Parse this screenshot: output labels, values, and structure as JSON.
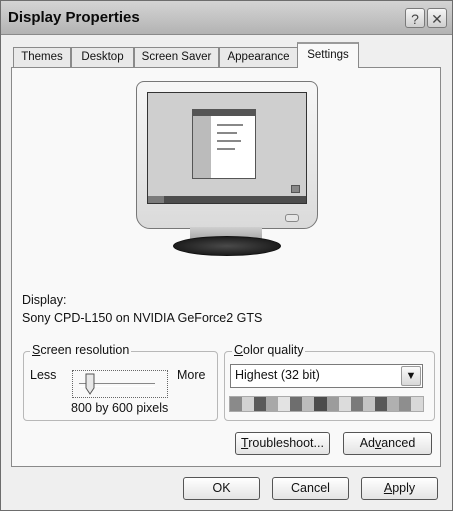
{
  "window": {
    "title": "Display Properties",
    "help_button": "?",
    "close_button": "✕"
  },
  "tabs": [
    {
      "label": "Themes"
    },
    {
      "label": "Desktop"
    },
    {
      "label": "Screen Saver"
    },
    {
      "label": "Appearance"
    },
    {
      "label": "Settings",
      "active": true
    }
  ],
  "display": {
    "label": "Display:",
    "device": "Sony CPD-L150 on NVIDIA GeForce2 GTS"
  },
  "resolution": {
    "group_label_first": "S",
    "group_label_rest": "creen resolution",
    "less_label": "Less",
    "more_label": "More",
    "value_text": "800 by 600 pixels",
    "slider_level": 0.15
  },
  "color_quality": {
    "group_label_first": "C",
    "group_label_rest": "olor quality",
    "selected": "Highest (32 bit)"
  },
  "panel_buttons": {
    "troubleshoot_first": "T",
    "troubleshoot_rest": "roubleshoot...",
    "advanced_pre": "Ad",
    "advanced_mnemonic": "v",
    "advanced_post": "anced"
  },
  "footer_buttons": {
    "ok": "OK",
    "cancel": "Cancel",
    "apply_first": "A",
    "apply_rest": "pply"
  },
  "colors": {
    "quality_bar": [
      "#8a8a8a",
      "#d2d2d2",
      "#5a5a5a",
      "#a8a8a8",
      "#e3e3e3",
      "#6e6e6e",
      "#bcbcbc",
      "#4c4c4c",
      "#9c9c9c",
      "#dcdcdc",
      "#7a7a7a",
      "#c4c4c4",
      "#585858",
      "#b0b0b0",
      "#8e8e8e",
      "#d8d8d8"
    ]
  }
}
